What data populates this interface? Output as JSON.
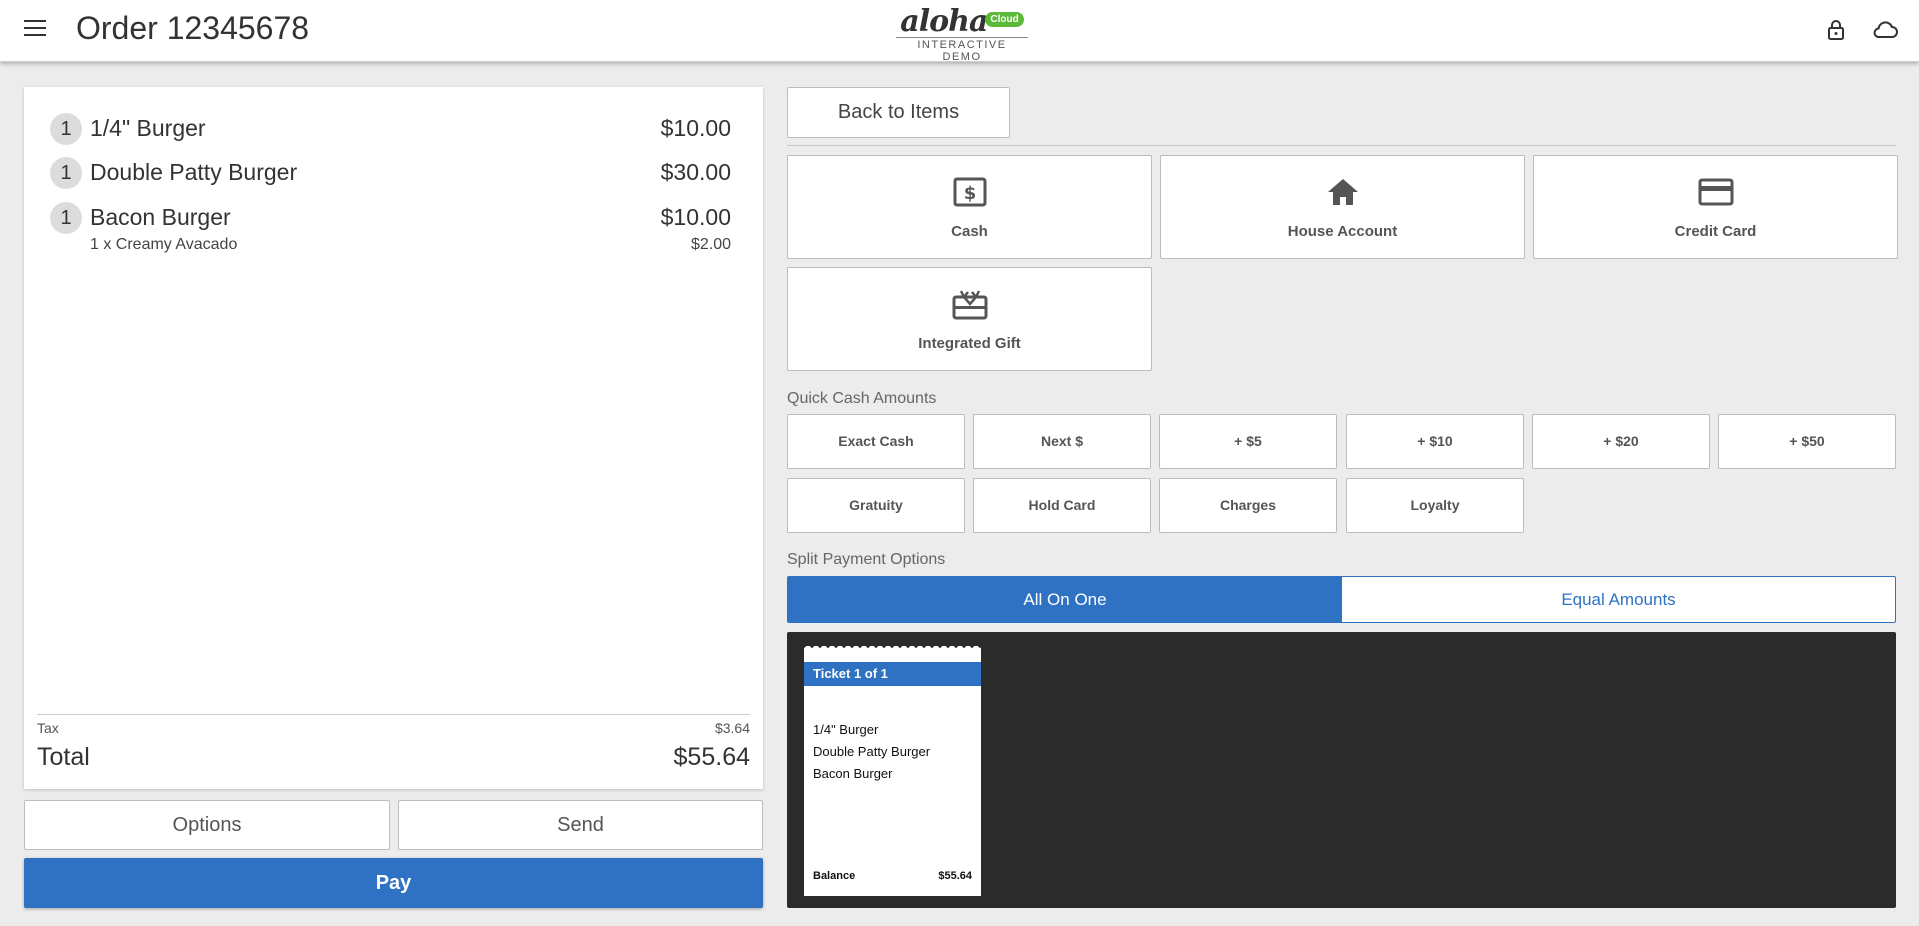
{
  "header": {
    "order_title": "Order 12345678",
    "logo_word": "aloha",
    "logo_badge": "Cloud",
    "logo_sub": "INTERACTIVE DEMO"
  },
  "order": {
    "items": [
      {
        "qty": "1",
        "name": "1/4\" Burger",
        "price": "$10.00"
      },
      {
        "qty": "1",
        "name": "Double Patty Burger",
        "price": "$30.00"
      },
      {
        "qty": "1",
        "name": "Bacon Burger",
        "price": "$10.00"
      }
    ],
    "modifier": {
      "name": "1 x Creamy Avacado",
      "price": "$2.00"
    },
    "tax_label": "Tax",
    "tax_value": "$3.64",
    "total_label": "Total",
    "total_value": "$55.64"
  },
  "actions": {
    "options": "Options",
    "send": "Send",
    "pay": "Pay",
    "back": "Back to Items"
  },
  "payment_types": [
    {
      "label": "Cash",
      "icon": "cash-icon"
    },
    {
      "label": "House Account",
      "icon": "house-icon"
    },
    {
      "label": "Credit Card",
      "icon": "credit-card-icon"
    },
    {
      "label": "Integrated Gift",
      "icon": "gift-card-icon"
    }
  ],
  "quick_cash": {
    "label": "Quick Cash Amounts",
    "row1": [
      "Exact Cash",
      "Next $",
      "+ $5",
      "+ $10",
      "+ $20",
      "+ $50"
    ],
    "row2": [
      "Gratuity",
      "Hold Card",
      "Charges",
      "Loyalty"
    ]
  },
  "split": {
    "label": "Split Payment Options",
    "active": "All On One",
    "inactive": "Equal Amounts"
  },
  "ticket": {
    "title": "Ticket 1 of 1",
    "items": [
      "1/4\" Burger",
      "Double Patty Burger",
      "Bacon Burger"
    ],
    "balance_label": "Balance",
    "balance_value": "$55.64"
  },
  "colors": {
    "accent": "#2f72c4",
    "brand_green": "#5cb837",
    "ticket_bg": "#2b2b2b"
  }
}
